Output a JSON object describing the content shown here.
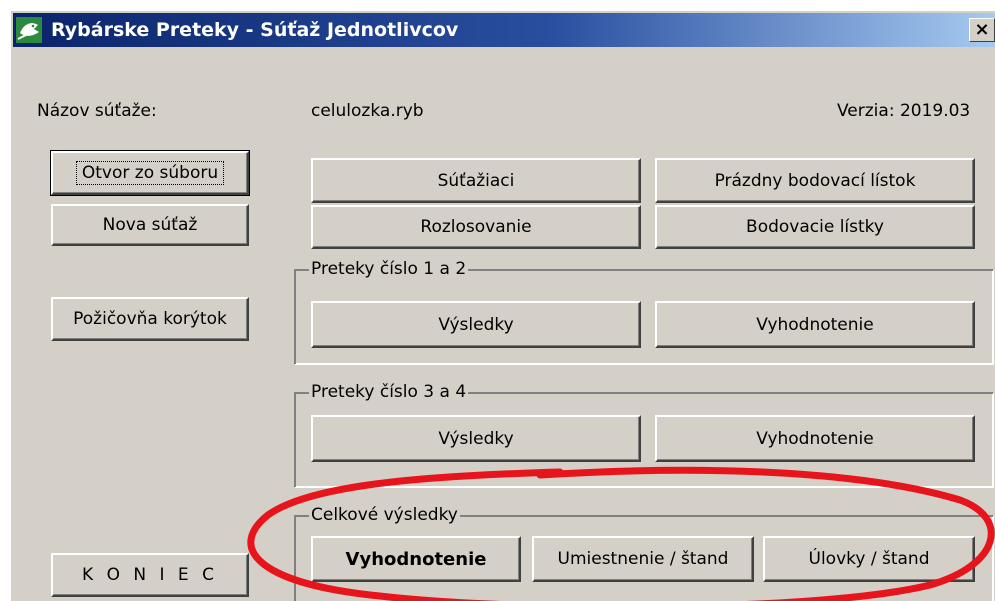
{
  "window": {
    "title": "Rybárske Preteky - Súťaž Jednotlivcov",
    "close_label": "×"
  },
  "info": {
    "name_label": "Názov súťaže:",
    "file_name": "celulozka.ryb",
    "version": "Verzia: 2019.03"
  },
  "left_buttons": {
    "open": "Otvor zo súboru",
    "new": "Nova súťaž",
    "rental": "Požičovňa korýtok",
    "exit": "K O N I E C"
  },
  "top_buttons": {
    "competitors": "Súťažiaci",
    "empty_sheet": "Prázdny bodovací lístok",
    "draw": "Rozlosovanie",
    "score_sheets": "Bodovacie lístky"
  },
  "group1": {
    "title": "Preteky číslo 1 a 2",
    "results": "Výsledky",
    "evaluation": "Vyhodnotenie"
  },
  "group2": {
    "title": "Preteky číslo 3 a 4",
    "results": "Výsledky",
    "evaluation": "Vyhodnotenie"
  },
  "group3": {
    "title": "Celkové výsledky",
    "evaluation": "Vyhodnotenie",
    "placement": "Umiestnenie / štand",
    "catches": "Úlovky / štand"
  },
  "colors": {
    "titlebar_start": "#0a246a",
    "titlebar_end": "#a6caf0",
    "face": "#d4d0c8",
    "annotation": "#e8141c"
  },
  "icons": {
    "app": "fish-app-icon",
    "close": "close-icon"
  }
}
